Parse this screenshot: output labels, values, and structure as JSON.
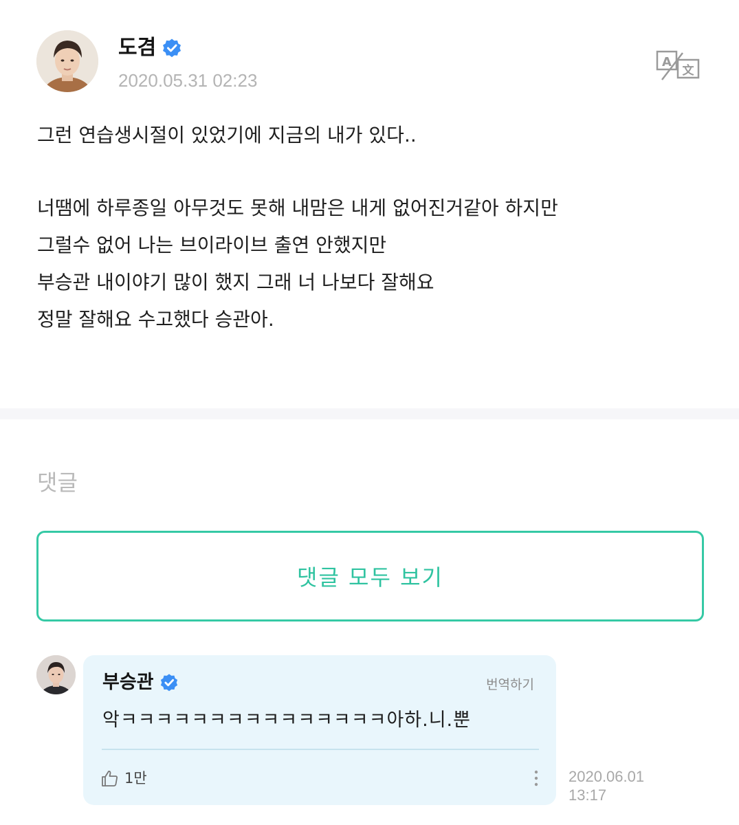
{
  "post": {
    "author": "도겸",
    "date": "2020.05.31 02:23",
    "lines": [
      "그런 연습생시절이 있었기에 지금의 내가 있다..",
      "너땜에 하루종일 아무것도 못해 내맘은 내게 없어진거같아 하지만",
      "그럴수 없어 나는 브이라이브 출연 안했지만",
      "부승관 내이야기 많이 했지 그래 너 나보다 잘해요",
      "정말 잘해요 수고했다 승관아."
    ]
  },
  "comments": {
    "heading": "댓글",
    "view_all_label": "댓글 모두 보기",
    "items": [
      {
        "author": "부승관",
        "translate_label": "번역하기",
        "text": "악ㅋㅋㅋㅋㅋㅋㅋㅋㅋㅋㅋㅋㅋㅋㅋ아하.니.뿐",
        "likes": "1만",
        "date": "2020.06.01",
        "time": "13:17"
      }
    ]
  },
  "colors": {
    "accent": "#35c9a5",
    "verified": "#3b8ff5",
    "bubble": "#e9f6fc"
  },
  "icons": {
    "verified": "verified-badge-icon",
    "translate": "translate-icon",
    "like": "thumbs-up-icon",
    "more": "more-vertical-icon"
  }
}
